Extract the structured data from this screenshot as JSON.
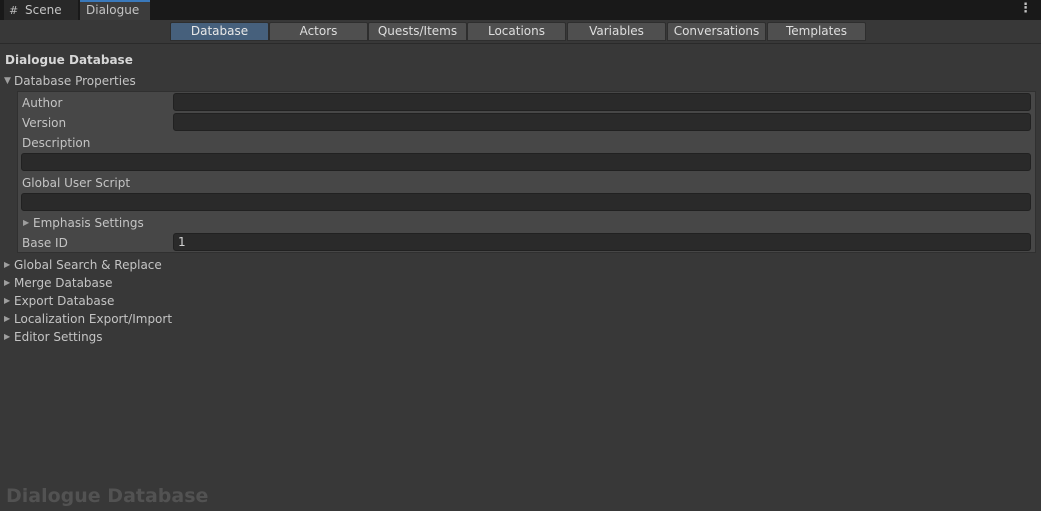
{
  "window_tabs": [
    {
      "label": "Scene",
      "icon": "grid-icon"
    },
    {
      "label": "Dialogue"
    }
  ],
  "toolbar_tabs": [
    "Database",
    "Actors",
    "Quests/Items",
    "Locations",
    "Variables",
    "Conversations",
    "Templates"
  ],
  "active_tab": "Database",
  "section_title": "Dialogue Database",
  "database_properties": {
    "header": "Database Properties",
    "author": {
      "label": "Author",
      "value": ""
    },
    "version": {
      "label": "Version",
      "value": ""
    },
    "description": {
      "label": "Description",
      "value": ""
    },
    "global_user_script": {
      "label": "Global User Script",
      "value": ""
    },
    "emphasis_settings": "Emphasis Settings",
    "base_id": {
      "label": "Base ID",
      "value": "1"
    }
  },
  "foldouts": [
    "Global Search & Replace",
    "Merge Database",
    "Export Database",
    "Localization Export/Import",
    "Editor Settings"
  ],
  "watermark": "Dialogue Database",
  "colors": {
    "background": "#383838",
    "active_tab": "#46607c",
    "accent": "#3a79bb"
  }
}
